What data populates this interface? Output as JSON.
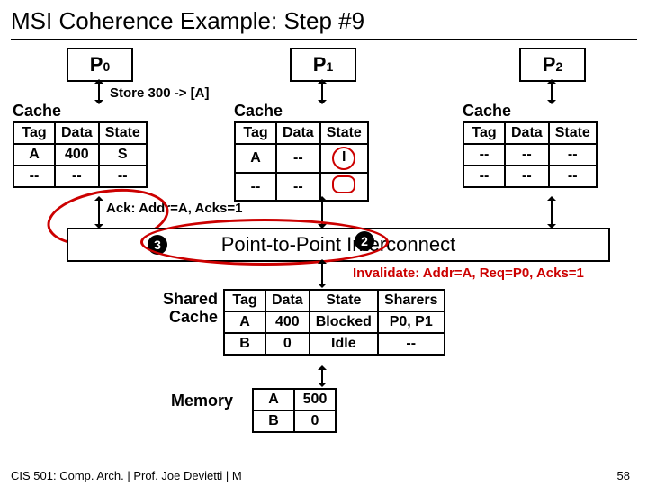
{
  "title": "MSI Coherence Example: Step #9",
  "procs": [
    "P",
    "P",
    "P"
  ],
  "proc_subs": [
    "0",
    "1",
    "2"
  ],
  "store_label": "Store 300 -> [A]",
  "cache_label": "Cache",
  "headers": {
    "tag": "Tag",
    "data": "Data",
    "state": "State"
  },
  "p0": {
    "r0": [
      "A",
      "400",
      "S"
    ],
    "r1": [
      "--",
      "--",
      "--"
    ]
  },
  "p1": {
    "r0": [
      "A",
      "--",
      "I"
    ],
    "r1": [
      "--",
      "--",
      ""
    ]
  },
  "p2": {
    "r0": [
      "--",
      "--",
      "--"
    ],
    "r1": [
      "--",
      "--",
      "--"
    ]
  },
  "ack": "Ack: Addr=A, Acks=1",
  "interconnect": "Point-to-Point Interconnect",
  "step3": "3",
  "step2": "2",
  "invalidate": "Invalidate: Addr=A, Req=P0, Acks=1",
  "shared_label1": "Shared",
  "shared_label2": "Cache",
  "shared": {
    "h": [
      "Tag",
      "Data",
      "State",
      "Sharers"
    ],
    "r0": [
      "A",
      "400",
      "Blocked",
      "P0, P1"
    ],
    "r1": [
      "B",
      "0",
      "Idle",
      "--"
    ]
  },
  "memory_label": "Memory",
  "mem": {
    "r0": [
      "A",
      "500"
    ],
    "r1": [
      "B",
      "0"
    ]
  },
  "footer": "CIS 501: Comp. Arch.  |  Prof. Joe Devietti  |  M",
  "slide": "58"
}
